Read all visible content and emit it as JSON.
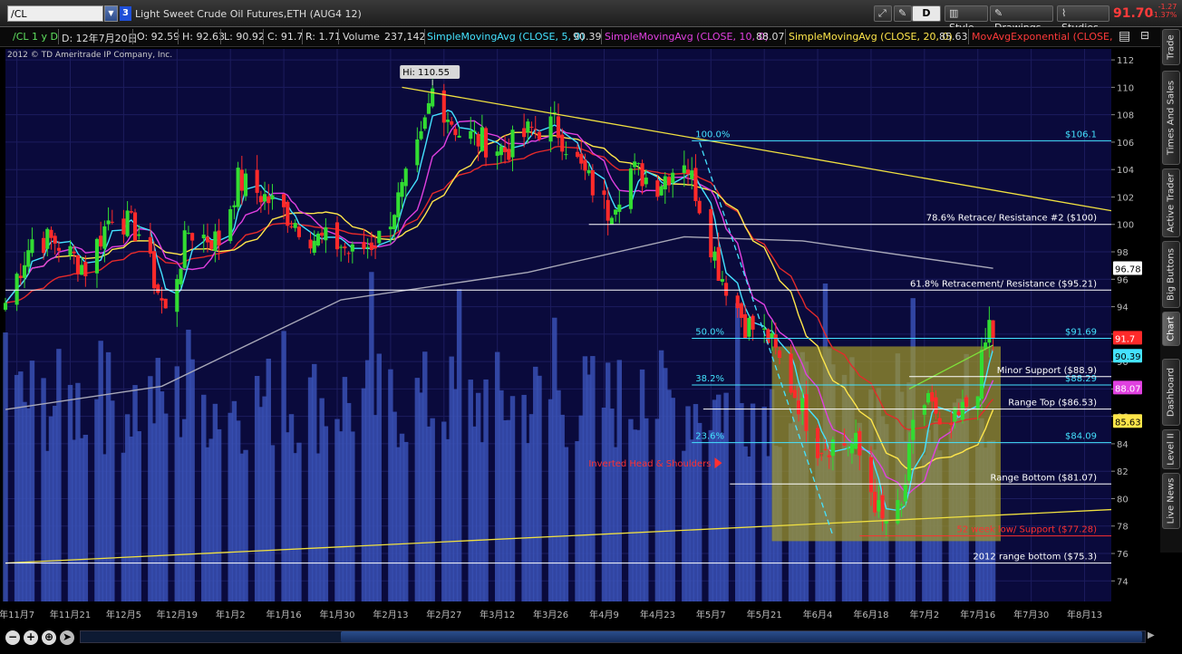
{
  "toolbar": {
    "symbol": "/CL",
    "link_badge": "3",
    "description": "Light Sweet Crude Oil Futures,ETH (AUG4 12)",
    "timeframe_button": "D",
    "style_label": "Style",
    "drawings_label": "Drawings",
    "studies_label": "Studies",
    "last_price": "91.70",
    "net_change": "-1.27",
    "net_change_pct": "-1.37%"
  },
  "header": {
    "symbol_period": "/CL 1 y D",
    "date": "D: 12年7月20日",
    "open": "O: 92.59",
    "high": "H: 92.63",
    "low": "L: 90.92",
    "close": "C: 91.7",
    "range": "R: 1.71",
    "volume_label": "Volume",
    "volume_value": "237,142",
    "sma5_label": "SimpleMovingAvg (CLOSE, 5, 0)",
    "sma5_value": "90.39",
    "sma10_label": "SimpleMovingAvg (CLOSE, 10, 0)",
    "sma10_value": "88.07",
    "sma20_label": "SimpleMovingAvg (CLOSE, 20, 0)",
    "sma20_value": "85.63",
    "ema_label": "MovAvgExponential (CLOSE, ..."
  },
  "copyright": "2012 © TD Ameritrade IP Company, Inc.",
  "colors": {
    "background": "#000000",
    "plot_background": "#0a0a3c",
    "volume": "#3850b4",
    "up_candle": "#32dc32",
    "down_candle": "#ff2a2a",
    "sma5": "#44e2ff",
    "sma10": "#e040e0",
    "sma20": "#ffe64a",
    "ema": "#e42a2a",
    "sma_long": "#a8a8b8",
    "trendline": "#f0e040",
    "fib": "#44e2ff",
    "range_box": "#a39a2a"
  },
  "side_tabs": [
    "Trade",
    "Times And Sales",
    "Active Trader",
    "Big Buttons",
    "Chart",
    "Dashboard",
    "Level II",
    "Live News"
  ],
  "chart_data": {
    "type": "candlestick",
    "title": "Light Sweet Crude Oil Futures,ETH (AUG4 12)",
    "ylim": [
      72.5,
      112.8
    ],
    "y_ticks": [
      74,
      76,
      78,
      80,
      82,
      84,
      86,
      88,
      90,
      92,
      94,
      96,
      98,
      100,
      102,
      104,
      106,
      108,
      110,
      112
    ],
    "x_domain_days": [
      "2011-11-04",
      "2012-08-20"
    ],
    "x_ticks": [
      {
        "date": "2011-11-07",
        "label": "年11月7"
      },
      {
        "date": "2011-11-21",
        "label": "年11月21"
      },
      {
        "date": "2011-12-05",
        "label": "年12月5"
      },
      {
        "date": "2011-12-19",
        "label": "年12月19"
      },
      {
        "date": "2012-01-02",
        "label": "年1月2"
      },
      {
        "date": "2012-01-16",
        "label": "年1月16"
      },
      {
        "date": "2012-01-30",
        "label": "年1月30"
      },
      {
        "date": "2012-02-13",
        "label": "年2月13"
      },
      {
        "date": "2012-02-27",
        "label": "年2月27"
      },
      {
        "date": "2012-03-12",
        "label": "年3月12"
      },
      {
        "date": "2012-03-26",
        "label": "年3月26"
      },
      {
        "date": "2012-04-09",
        "label": "年4月9"
      },
      {
        "date": "2012-04-23",
        "label": "年4月23"
      },
      {
        "date": "2012-05-07",
        "label": "年5月7"
      },
      {
        "date": "2012-05-21",
        "label": "年5月21"
      },
      {
        "date": "2012-06-04",
        "label": "年6月4"
      },
      {
        "date": "2012-06-18",
        "label": "年6月18"
      },
      {
        "date": "2012-07-02",
        "label": "年7月2"
      },
      {
        "date": "2012-07-16",
        "label": "年7月16"
      },
      {
        "date": "2012-07-30",
        "label": "年7月30"
      },
      {
        "date": "2012-08-13",
        "label": "年8月13"
      }
    ],
    "close_path": [
      [
        "2011-11-04",
        94.3
      ],
      [
        "2011-11-11",
        98.9
      ],
      [
        "2011-11-17",
        98.8
      ],
      [
        "2011-11-25",
        96.8
      ],
      [
        "2011-12-02",
        100.9
      ],
      [
        "2011-12-09",
        99.4
      ],
      [
        "2011-12-16",
        93.5
      ],
      [
        "2011-12-22",
        99.5
      ],
      [
        "2011-12-30",
        98.8
      ],
      [
        "2012-01-04",
        103.2
      ],
      [
        "2012-01-10",
        102.2
      ],
      [
        "2012-01-17",
        100.7
      ],
      [
        "2012-01-24",
        99.0
      ],
      [
        "2012-01-31",
        98.5
      ],
      [
        "2012-02-03",
        97.8
      ],
      [
        "2012-02-10",
        99.0
      ],
      [
        "2012-02-16",
        102.3
      ],
      [
        "2012-02-21",
        106.0
      ],
      [
        "2012-02-24",
        109.8
      ],
      [
        "2012-03-02",
        106.7
      ],
      [
        "2012-03-07",
        106.2
      ],
      [
        "2012-03-14",
        105.4
      ],
      [
        "2012-03-21",
        106.9
      ],
      [
        "2012-03-27",
        107.3
      ],
      [
        "2012-04-03",
        104.0
      ],
      [
        "2012-04-10",
        101.0
      ],
      [
        "2012-04-16",
        104.0
      ],
      [
        "2012-04-23",
        103.0
      ],
      [
        "2012-04-30",
        104.9
      ],
      [
        "2012-05-03",
        102.5
      ],
      [
        "2012-05-09",
        96.8
      ],
      [
        "2012-05-16",
        92.8
      ],
      [
        "2012-05-22",
        91.7
      ],
      [
        "2012-05-31",
        86.5
      ],
      [
        "2012-06-04",
        83.9
      ],
      [
        "2012-06-08",
        84.1
      ],
      [
        "2012-06-14",
        83.9
      ],
      [
        "2012-06-21",
        78.2
      ],
      [
        "2012-06-26",
        79.2
      ],
      [
        "2012-06-29",
        84.9
      ],
      [
        "2012-07-03",
        87.7
      ],
      [
        "2012-07-06",
        84.5
      ],
      [
        "2012-07-11",
        85.8
      ],
      [
        "2012-07-16",
        88.4
      ],
      [
        "2012-07-19",
        92.7
      ],
      [
        "2012-07-20",
        91.7
      ]
    ],
    "sma_long_path": [
      [
        "2011-11-04",
        86.5
      ],
      [
        "2011-12-15",
        88.2
      ],
      [
        "2012-01-31",
        94.5
      ],
      [
        "2012-03-20",
        96.5
      ],
      [
        "2012-04-30",
        99.1
      ],
      [
        "2012-05-31",
        98.8
      ],
      [
        "2012-07-20",
        96.8
      ]
    ],
    "series": [
      {
        "name": "SimpleMovingAvg (CLOSE, 5, 0)",
        "last": 90.39
      },
      {
        "name": "SimpleMovingAvg (CLOSE, 10, 0)",
        "last": 88.07
      },
      {
        "name": "SimpleMovingAvg (CLOSE, 20, 0)",
        "last": 85.63
      },
      {
        "name": "MovAvgExponential (CLOSE, ...",
        "last": null
      }
    ],
    "price_tags": [
      {
        "value": 96.78,
        "label": "96.78",
        "bg": "#ffffff",
        "fg": "#000000"
      },
      {
        "value": 91.7,
        "label": "91.7",
        "bg": "#ff2a2a",
        "fg": "#ffffff"
      },
      {
        "value": 90.39,
        "label": "90.39",
        "bg": "#44e2ff",
        "fg": "#000000"
      },
      {
        "value": 88.07,
        "label": "88.07",
        "bg": "#e040e0",
        "fg": "#ffffff"
      },
      {
        "value": 85.63,
        "label": "85.63",
        "bg": "#ffe64a",
        "fg": "#000000"
      }
    ],
    "high_marker": {
      "date": "2012-02-24",
      "value": 110.55,
      "label": "Hi: 110.55"
    },
    "fib_levels": [
      {
        "value": 106.1,
        "pct_label": "100.0%",
        "price_label": "$106.1"
      },
      {
        "value": 91.69,
        "pct_label": "50.0%",
        "price_label": "$91.69"
      },
      {
        "value": 88.29,
        "pct_label": "38.2%",
        "price_label": "$88.29"
      },
      {
        "value": 84.09,
        "pct_label": "23.6%",
        "price_label": "$84.09"
      }
    ],
    "level_lines": [
      {
        "value": 100.0,
        "start": "2012-04-05",
        "label": "78.6% Retrace/ Resistance #2 ($100)"
      },
      {
        "value": 95.21,
        "start": "2011-11-04",
        "label": "61.8% Retracement/ Resistance ($95.21)"
      },
      {
        "value": 88.9,
        "start": "2012-06-28",
        "label": "Minor Support ($88.9)"
      },
      {
        "value": 86.53,
        "start": "2012-05-05",
        "label": "Range Top ($86.53)"
      },
      {
        "value": 81.07,
        "start": "2012-05-12",
        "label": "Range Bottom ($81.07)"
      },
      {
        "value": 77.28,
        "start": "2012-06-15",
        "label": "52 week low/ Support ($77.28)",
        "color": "#ff3030"
      },
      {
        "value": 75.3,
        "start": "2011-11-04",
        "label": "2012 range bottom ($75.3)"
      }
    ],
    "trendlines": [
      {
        "name": "resistance-trendline",
        "from": [
          "2012-02-16",
          110.0
        ],
        "to": [
          "2012-08-20",
          101.0
        ]
      },
      {
        "name": "neckline-trendline",
        "from": [
          "2011-11-04",
          75.3
        ],
        "to": [
          "2012-08-20",
          79.2
        ]
      },
      {
        "name": "breakout-trendline",
        "from": [
          "2012-06-28",
          88.0
        ],
        "to": [
          "2012-07-20",
          91.2
        ]
      }
    ],
    "range_box": {
      "from": "2012-05-23",
      "to": "2012-07-22",
      "top": 91.1,
      "bottom": 76.9
    },
    "annotations": [
      {
        "text": "Inverted Head & Shoulders",
        "date": "2012-05-08",
        "value": 82.6
      }
    ]
  }
}
